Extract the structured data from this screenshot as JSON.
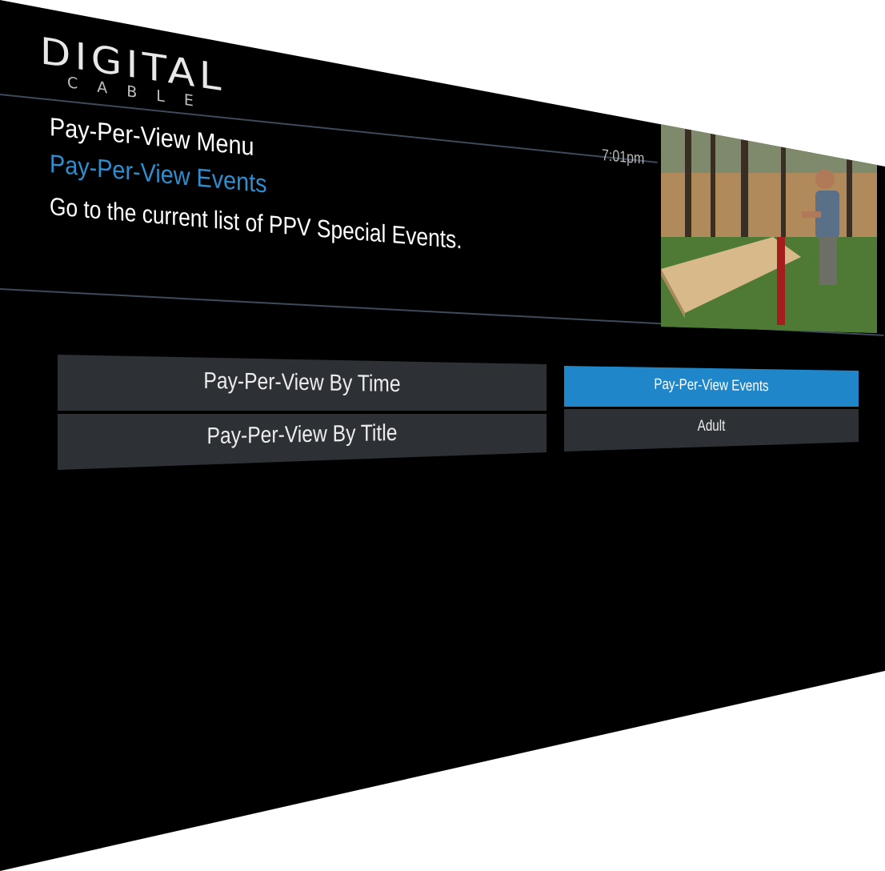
{
  "brand": {
    "logo_word": "DIGITAL",
    "logo_sub": "CABLE"
  },
  "header": {
    "menu_title": "Pay-Per-View Menu",
    "selected_title": "Pay-Per-View Events",
    "description": "Go to the current list of PPV Special Events.",
    "clock": "7:01pm"
  },
  "preview": {
    "icon": "live-tv-preview-image"
  },
  "menu": {
    "left_buttons": [
      {
        "label": "Pay-Per-View By Time"
      },
      {
        "label": "Pay-Per-View By Title"
      }
    ],
    "right_buttons": [
      {
        "label": "Pay-Per-View Events",
        "selected": true
      },
      {
        "label": "Adult",
        "selected": false
      }
    ]
  },
  "colors": {
    "panel_bg": "#000000",
    "accent": "#1f86c9",
    "selected_text": "#2d8fd0",
    "button_bg": "#2d3136"
  }
}
